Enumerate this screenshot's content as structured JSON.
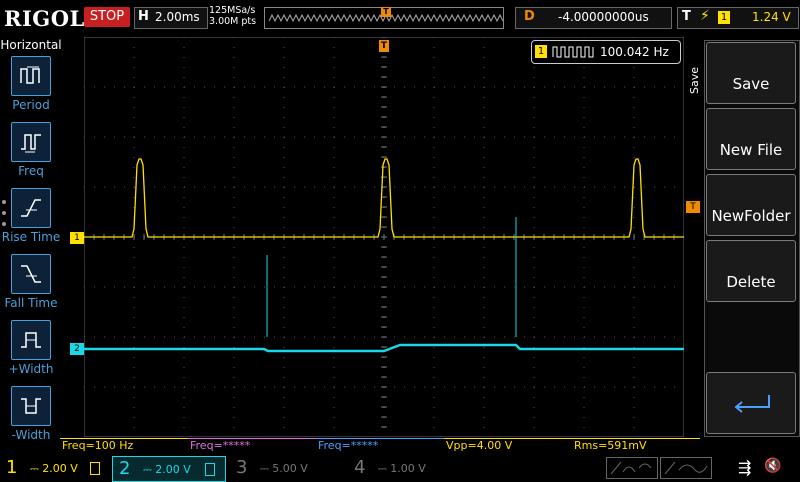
{
  "brand": "RIGOL",
  "run_state": "STOP",
  "horizontal": {
    "label": "H",
    "scale": "2.00ms"
  },
  "sample": {
    "rate": "125MSa/s",
    "points": "3.00M pts"
  },
  "trigger_marker": "T",
  "delay": {
    "label": "D",
    "value": "-4.00000000us"
  },
  "trigger": {
    "label": "T",
    "edge_icon": "rising-edge-icon",
    "source": "1",
    "level": "1.24 V"
  },
  "left_menu": {
    "title": "Horizontal",
    "items": [
      {
        "label": "Period",
        "icon": "period-icon"
      },
      {
        "label": "Freq",
        "icon": "freq-icon"
      },
      {
        "label": "Rise Time",
        "icon": "rise-time-icon"
      },
      {
        "label": "Fall Time",
        "icon": "fall-time-icon"
      },
      {
        "label": "+Width",
        "icon": "pos-width-icon"
      },
      {
        "label": "-Width",
        "icon": "neg-width-icon"
      }
    ]
  },
  "freq_counter": {
    "channel": "1",
    "value": "100.042 Hz"
  },
  "channel_markers": {
    "ch1": "1",
    "ch2": "2",
    "trigger_level": "T"
  },
  "right_menu": {
    "tab": "Save",
    "buttons": [
      "Save",
      "New File",
      "NewFolder",
      "Delete"
    ],
    "enter_icon": "enter-arrow-icon"
  },
  "measurements": [
    {
      "text": "Freq=100 Hz",
      "color": "#ffe000"
    },
    {
      "text": "Freq=*****",
      "color": "#e070e0"
    },
    {
      "text": "Freq=*****",
      "color": "#4aa0ff"
    },
    {
      "text": "Vpp=4.00 V",
      "color": "#ffe000"
    },
    {
      "text": "Rms=591mV",
      "color": "#ffe000"
    }
  ],
  "channels": [
    {
      "num": "1",
      "scale": "2.00 V",
      "color": "#ffe000",
      "active": true
    },
    {
      "num": "2",
      "scale": "2.00 V",
      "color": "#19d8e8",
      "active": true
    },
    {
      "num": "3",
      "scale": "5.00 V",
      "color": "#777777",
      "active": false
    },
    {
      "num": "4",
      "scale": "1.00 V",
      "color": "#777777",
      "active": false
    }
  ],
  "status_icons": [
    "math-icon",
    "ref-icon",
    "usb-icon",
    "sound-icon"
  ],
  "colors": {
    "ch1": "#ffe000",
    "ch2": "#19d8e8",
    "accent": "#f08a00",
    "menu": "#4aa0d8"
  }
}
